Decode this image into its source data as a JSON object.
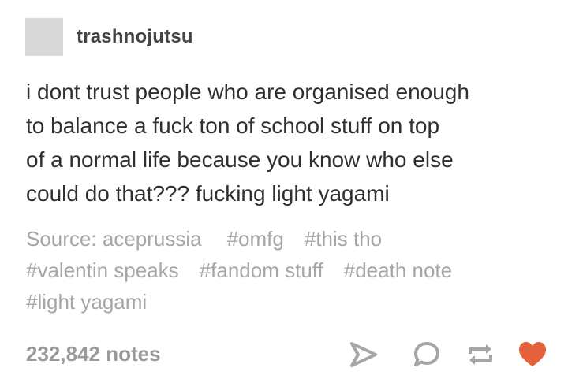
{
  "post": {
    "username": "trashnojutsu",
    "body_lines": [
      "i dont trust people who are organised enough",
      "to balance a fuck ton of school stuff on top",
      "of a normal life because you know who else",
      "could do that??? fucking light yagami"
    ],
    "source_label": "Source: aceprussia",
    "tags": [
      "#omfg",
      "#this tho",
      "#valentin speaks",
      "#fandom stuff",
      "#death note",
      "#light yagami"
    ],
    "notes": "232,842 notes"
  },
  "actions": [
    {
      "name": "share-icon",
      "color": "#a6a6a6"
    },
    {
      "name": "reply-icon",
      "color": "#a6a6a6"
    },
    {
      "name": "reblog-icon",
      "color": "#a6a6a6"
    },
    {
      "name": "like-heart-icon",
      "color": "#e4613a",
      "liked": true
    }
  ],
  "colors": {
    "avatar": "#d9d9d9",
    "meta_text": "#a6a6a6",
    "like": "#e4613a"
  }
}
